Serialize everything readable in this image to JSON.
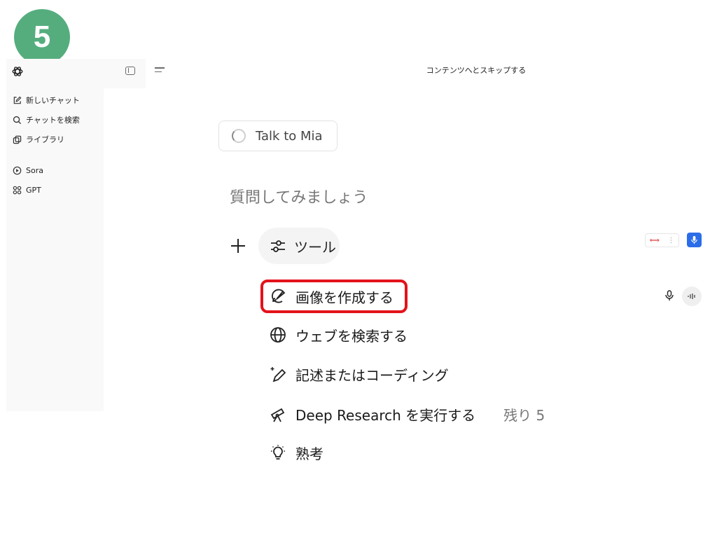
{
  "step_badge": "5",
  "topbar": {
    "skip_link": "コンテンツへとスキップする"
  },
  "sidebar": {
    "items": [
      {
        "label": "新しいチャット",
        "icon": "new-chat-icon"
      },
      {
        "label": "チャットを検索",
        "icon": "search-icon"
      },
      {
        "label": "ライブラリ",
        "icon": "library-icon"
      },
      {
        "label": "Sora",
        "icon": "play-icon"
      },
      {
        "label": "GPT",
        "icon": "grid-icon"
      }
    ]
  },
  "main": {
    "talk_card_label": "Talk to Mia",
    "prompt_placeholder": "質問してみましょう",
    "tools_label": "ツール",
    "tool_menu": [
      {
        "label": "画像を作成する",
        "icon": "paintbrush-icon"
      },
      {
        "label": "ウェブを検索する",
        "icon": "globe-icon"
      },
      {
        "label": "記述またはコーディング",
        "icon": "pen-sparkle-icon"
      },
      {
        "label": "Deep Research を実行する",
        "icon": "telescope-icon",
        "remaining": "残り 5"
      },
      {
        "label": "熟考",
        "icon": "lightbulb-icon"
      }
    ]
  },
  "colors": {
    "badge": "#55ad7e",
    "highlight": "#e3131b",
    "mic_button": "#2b6de8"
  }
}
